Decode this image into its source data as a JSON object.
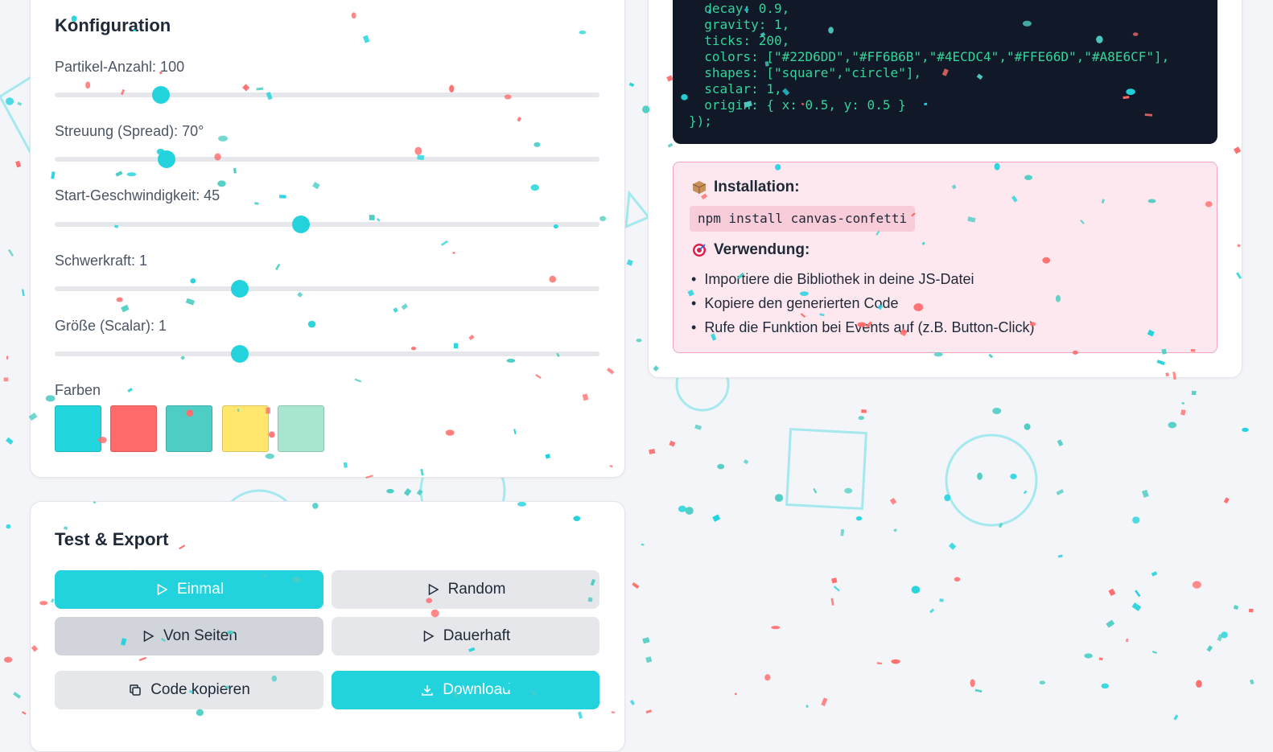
{
  "config": {
    "title": "Konfiguration",
    "sliders": [
      {
        "label": "Partikel-Anzahl: 100",
        "value_fraction": 0.195
      },
      {
        "label": "Streuung (Spread): 70°",
        "value_fraction": 0.205
      },
      {
        "label": "Start-Geschwindigkeit: 45",
        "value_fraction": 0.452
      },
      {
        "label": "Schwerkraft: 1",
        "value_fraction": 0.34
      },
      {
        "label": "Größe (Scalar): 1",
        "value_fraction": 0.34
      }
    ],
    "colors_label": "Farben",
    "colors": [
      "#22D6DD",
      "#FF6B6B",
      "#4ECDC4",
      "#FFE66D",
      "#A8E6CF"
    ]
  },
  "test": {
    "title": "Test & Export",
    "buttons": {
      "once": "Einmal",
      "random": "Random",
      "sides": "Von Seiten",
      "continuous": "Dauerhaft",
      "copy": "Code kopieren",
      "download": "Download"
    }
  },
  "code": {
    "lines": [
      "  decay: 0.9,",
      "  gravity: 1,",
      "  ticks: 200,",
      "  colors: [\"#22D6DD\",\"#FF6B6B\",\"#4ECDC4\",\"#FFE66D\",\"#A8E6CF\"],",
      "  shapes: [\"square\",\"circle\"],",
      "  scalar: 1,",
      "  origin: { x: 0.5, y: 0.5 }",
      "});"
    ]
  },
  "info": {
    "install_title": "Installation:",
    "install_cmd": "npm install canvas-confetti",
    "usage_title": "Verwendung:",
    "steps": [
      "Importiere die Bibliothek in deine JS-Datei",
      "Kopiere den generierten Code",
      "Rufe die Funktion bei Events auf (z.B. Button-Click)"
    ]
  },
  "theme": {
    "accent": "#22d3dd",
    "code_bg": "#111827",
    "code_fg": "#34d399",
    "info_bg": "#fde8ef"
  }
}
